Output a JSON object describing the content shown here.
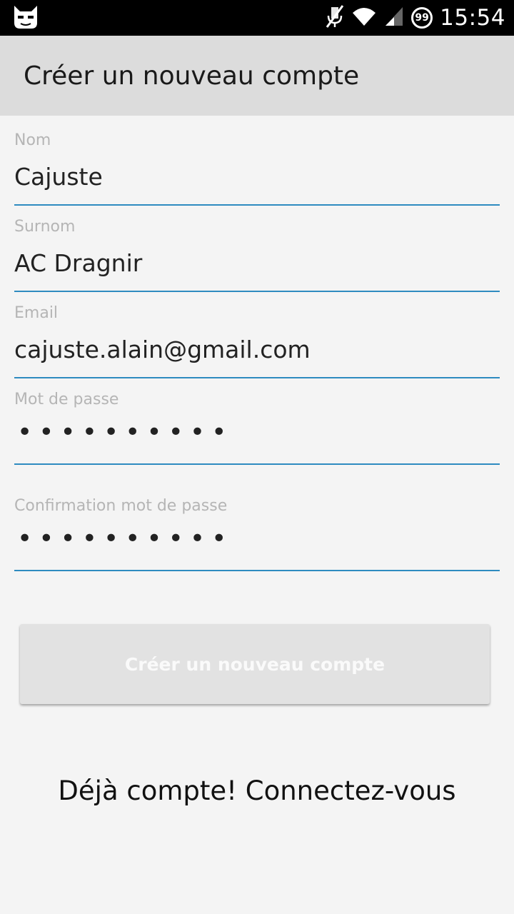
{
  "status_bar": {
    "time": "15:54",
    "notification_count": "99",
    "icons": [
      "cyanogenmod-bugdroid-icon",
      "mute-icon",
      "wifi-icon",
      "signal-icon",
      "notification-count-icon"
    ]
  },
  "action_bar": {
    "title": "Créer un nouveau compte"
  },
  "form": {
    "nom": {
      "label": "Nom",
      "value": "Cajuste"
    },
    "surnom": {
      "label": "Surnom",
      "value": "AC Dragnir"
    },
    "email": {
      "label": "Email",
      "value": "cajuste.alain@gmail.com"
    },
    "password": {
      "label": "Mot de passe",
      "value": "••••••••••"
    },
    "password_confirm": {
      "label": "Confirmation mot de passe",
      "value": "••••••••••"
    }
  },
  "submit_button": {
    "label": "Créer un nouveau compte"
  },
  "login_link": {
    "label": "Déjà compte! Connectez-vous"
  },
  "colors": {
    "accent": "#2e8bc0",
    "action_bar_bg": "#dcdcdc",
    "page_bg": "#f4f4f4",
    "status_bar_bg": "#000000"
  }
}
